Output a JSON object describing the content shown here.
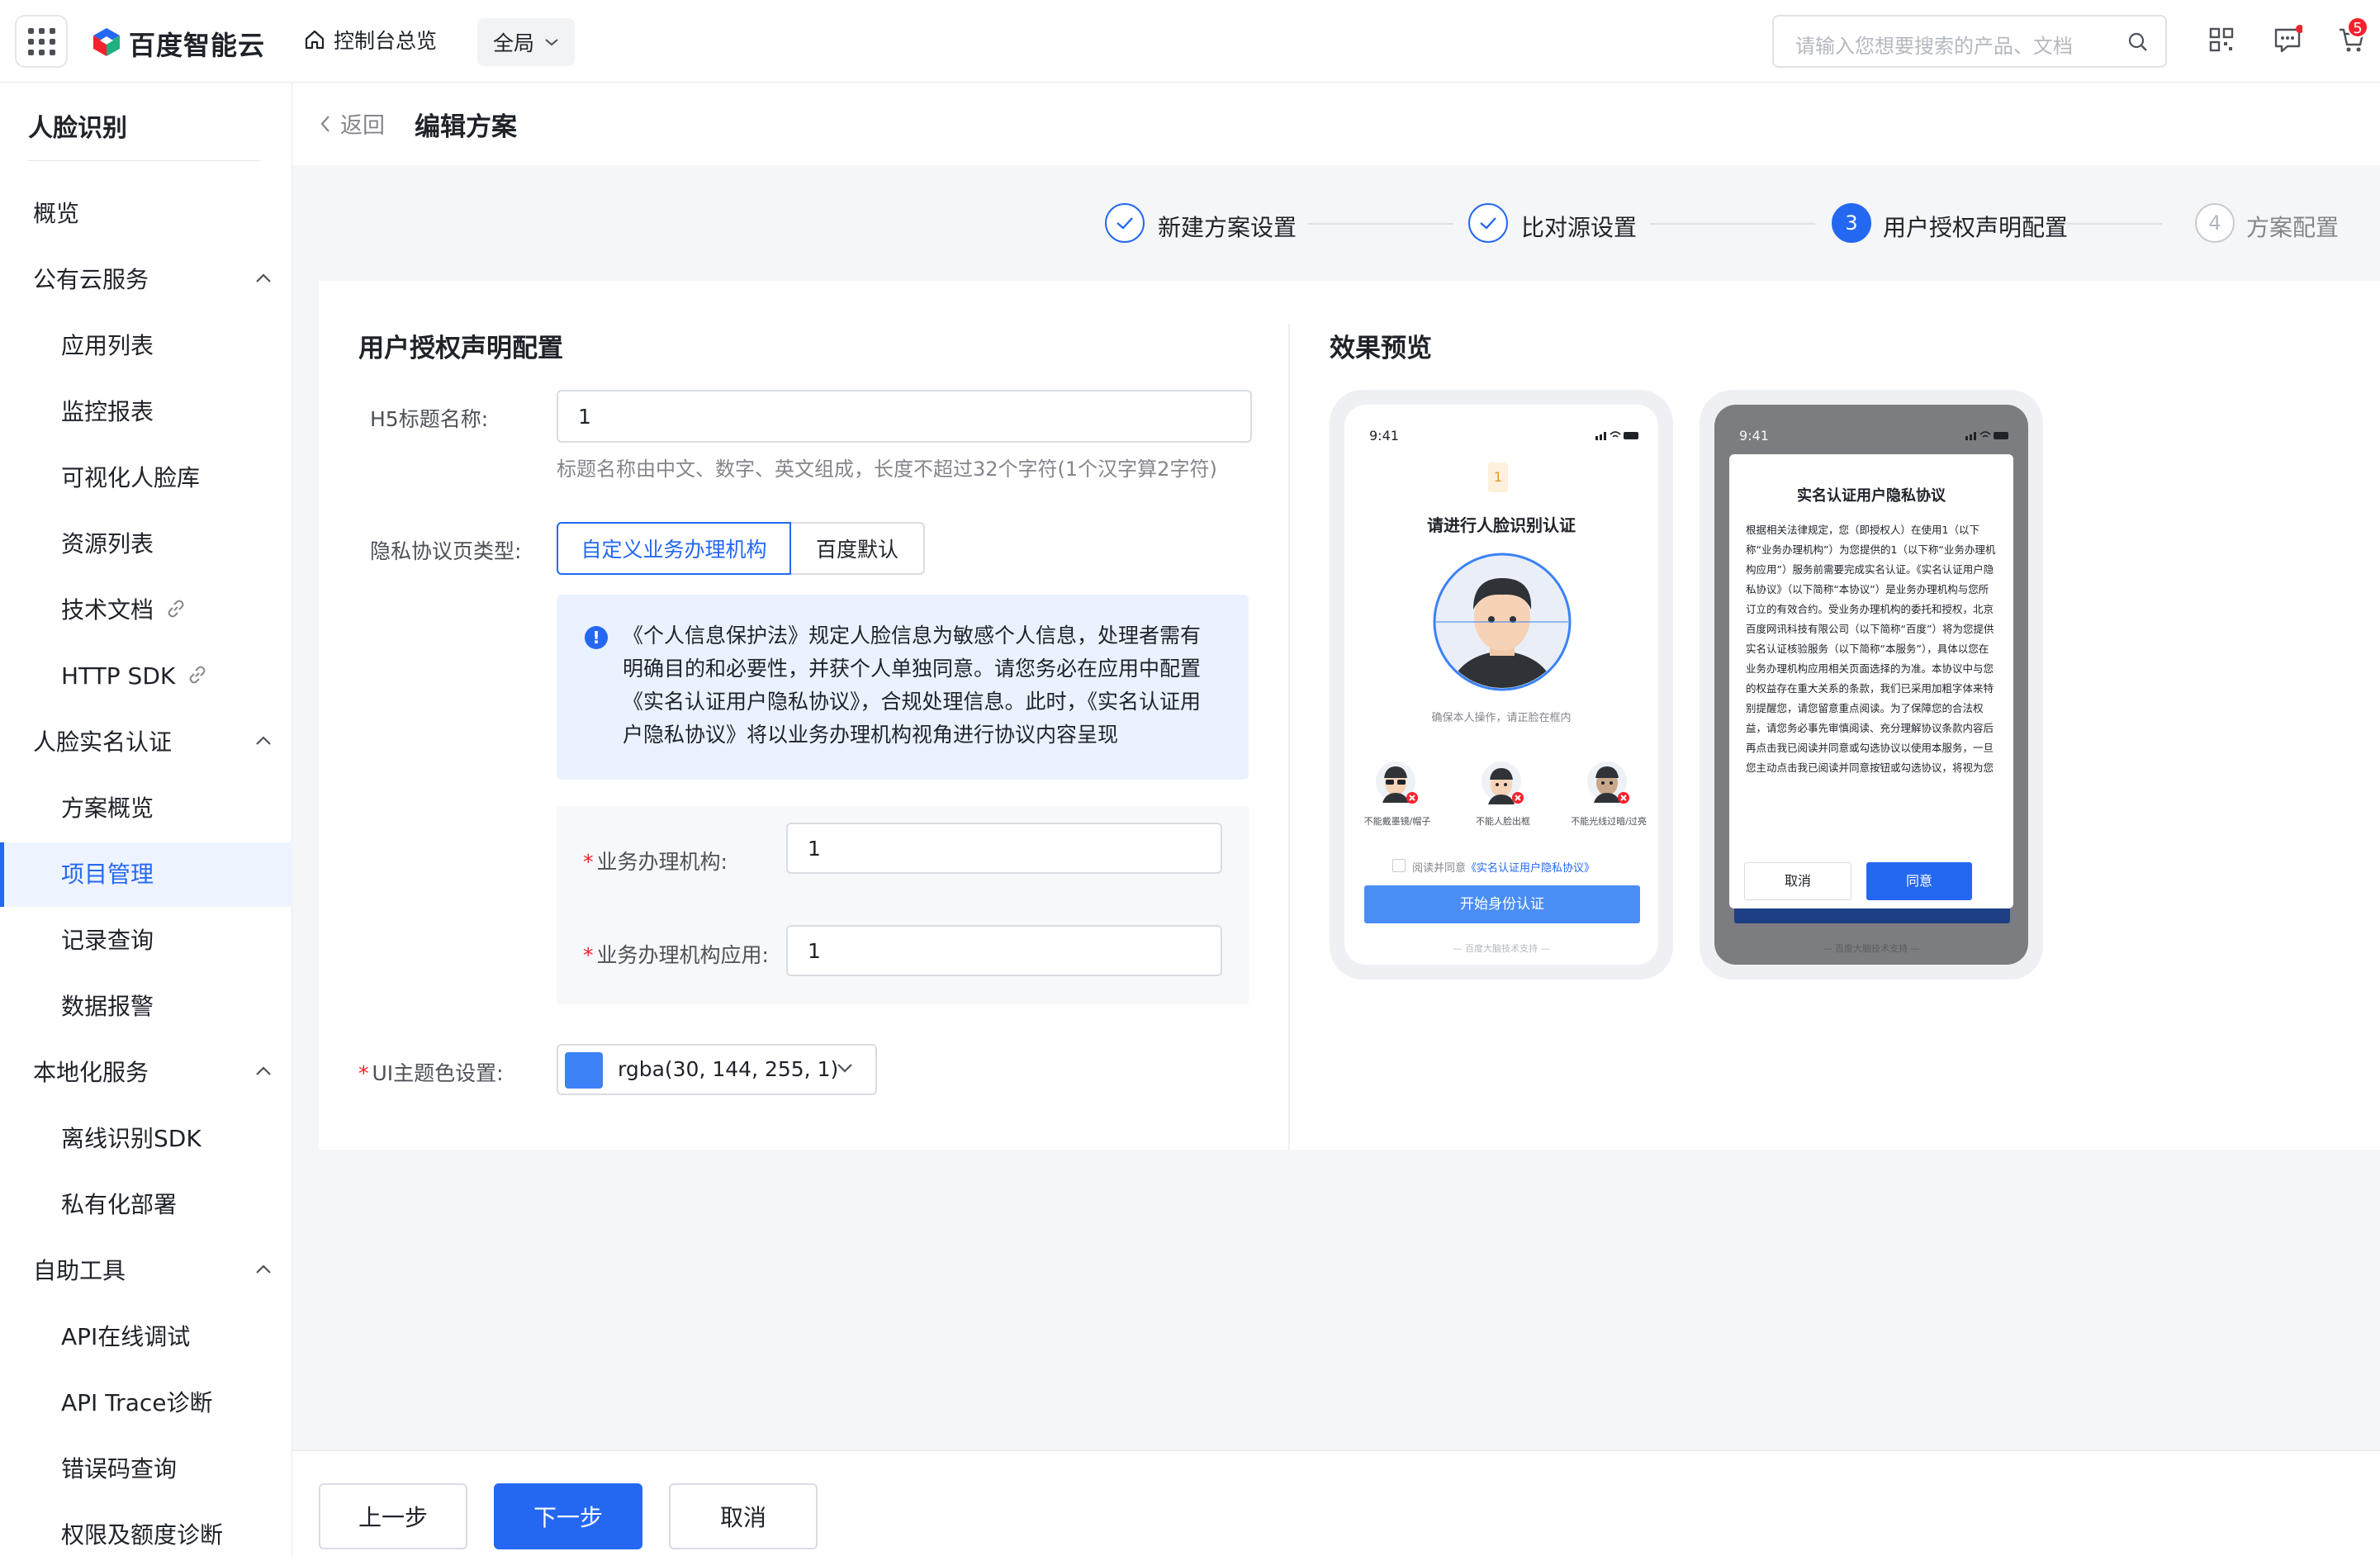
{
  "topbar": {
    "logo_text": "百度智能云",
    "home_label": "控制台总览",
    "region_label": "全局",
    "search_placeholder": "请输入您想要搜索的产品、文档",
    "cart_badge": "5"
  },
  "sidebar": {
    "title": "人脸识别",
    "items": [
      {
        "label": "概览",
        "type": "top"
      },
      {
        "label": "公有云服务",
        "type": "group"
      },
      {
        "label": "应用列表",
        "type": "sub"
      },
      {
        "label": "监控报表",
        "type": "sub"
      },
      {
        "label": "可视化人脸库",
        "type": "sub"
      },
      {
        "label": "资源列表",
        "type": "sub"
      },
      {
        "label": "技术文档",
        "type": "sub",
        "link": true
      },
      {
        "label": "HTTP SDK",
        "type": "sub",
        "link": true
      },
      {
        "label": "人脸实名认证",
        "type": "group"
      },
      {
        "label": "方案概览",
        "type": "sub"
      },
      {
        "label": "项目管理",
        "type": "sub",
        "active": true
      },
      {
        "label": "记录查询",
        "type": "sub"
      },
      {
        "label": "数据报警",
        "type": "sub"
      },
      {
        "label": "本地化服务",
        "type": "group"
      },
      {
        "label": "离线识别SDK",
        "type": "sub"
      },
      {
        "label": "私有化部署",
        "type": "sub"
      },
      {
        "label": "自助工具",
        "type": "group"
      },
      {
        "label": "API在线调试",
        "type": "sub"
      },
      {
        "label": "API Trace诊断",
        "type": "sub"
      },
      {
        "label": "错误码查询",
        "type": "sub"
      },
      {
        "label": "权限及额度诊断",
        "type": "sub"
      }
    ]
  },
  "header": {
    "back_label": "返回",
    "title": "编辑方案"
  },
  "steps": [
    {
      "label": "新建方案设置",
      "state": "done",
      "num": "1"
    },
    {
      "label": "比对源设置",
      "state": "done",
      "num": "2"
    },
    {
      "label": "用户授权声明配置",
      "state": "current",
      "num": "3"
    },
    {
      "label": "方案配置",
      "state": "todo",
      "num": "4"
    }
  ],
  "form": {
    "section_title": "用户授权声明配置",
    "h5_title_label": "H5标题名称:",
    "h5_title_value": "1",
    "h5_title_hint": "标题名称由中文、数字、英文组成，长度不超过32个字符(1个汉字算2字符)",
    "privacy_type_label": "隐私协议页类型:",
    "privacy_options": [
      "自定义业务办理机构",
      "百度默认"
    ],
    "privacy_selected": "自定义业务办理机构",
    "alert_icon": "!",
    "alert_text": "《个人信息保护法》规定人脸信息为敏感个人信息，处理者需有明确目的和必要性，并获个人单独同意。请您务必在应用中配置《实名认证用户隐私协议》，合规处理信息。此时，《实名认证用户隐私协议》将以业务办理机构视角进行协议内容呈现",
    "org_label": "业务办理机构:",
    "org_value": "1",
    "org_app_label": "业务办理机构应用:",
    "org_app_value": "1",
    "theme_label": "UI主题色设置:",
    "theme_value": "rgba(30, 144, 255, 1)",
    "theme_color": "#3c82f6"
  },
  "preview": {
    "title": "效果预览",
    "time": "9:41",
    "phone1": {
      "badge": "1",
      "heading": "请进行人脸识别认证",
      "caption": "确保本人操作，请正脸在框内",
      "tips": [
        "不能戴墨镜/帽子",
        "不能人脸出框",
        "不能光线过暗/过亮"
      ],
      "agree_prefix": "阅读并同意",
      "agree_link": "《实名认证用户隐私协议》",
      "start_button": "开始身份认证",
      "footer": "— 百度大脑技术支持 —"
    },
    "phone2": {
      "dialog_title": "实名认证用户隐私协议",
      "dialog_text": "根据相关法律规定，您（即授权人）在使用1（以下称“业务办理机构”）为您提供的1（以下称“业务办理机构应用”）服务前需要完成实名认证。《实名认证用户隐私协议》（以下简称“本协议”）是业务办理机构与您所订立的有效合约。受业务办理机构的委托和授权，北京百度网讯科技有限公司（以下简称“百度”）将为您提供实名认证核验服务（以下简称“本服务”），具体以您在业务办理机构应用相关页面选择的为准。本协议中与您的权益存在重大关系的条款，我们已采用加粗字体来特别提醒您，请您留意重点阅读。为了保障您的合法权益，请您务必事先审慎阅读、充分理解协议条款内容后再点击我已阅读并同意或勾选协议以使用本服务，一旦您主动点击我已阅读并同意按钮或勾选协议，将视为您",
      "cancel": "取消",
      "agree": "同意",
      "footer": "— 百度大脑技术支持 —"
    }
  },
  "footer": {
    "prev": "上一步",
    "next": "下一步",
    "cancel": "取消"
  },
  "colors": {
    "primary": "#2468f2",
    "alert_bg": "#eaf2ff",
    "danger": "#f5222d"
  }
}
